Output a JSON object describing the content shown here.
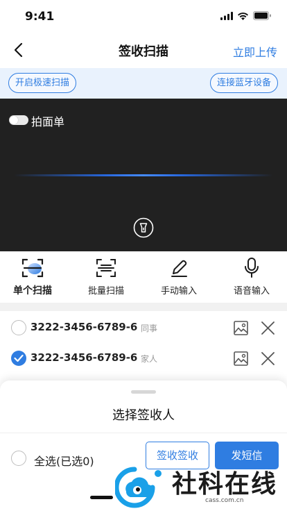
{
  "status_bar": {
    "time": "9:41"
  },
  "nav": {
    "title": "签收扫描",
    "action": "立即上传"
  },
  "options": {
    "fast_scan": "开启极速扫描",
    "bluetooth": "连接蓝牙设备"
  },
  "camera": {
    "toggle_label": "拍面单",
    "toggle_on": false
  },
  "modes": [
    {
      "label": "单个扫描",
      "icon": "scan-frame-icon",
      "active": true
    },
    {
      "label": "批量扫描",
      "icon": "batch-scan-icon",
      "active": false
    },
    {
      "label": "手动输入",
      "icon": "pen-icon",
      "active": false
    },
    {
      "label": "语音输入",
      "icon": "microphone-icon",
      "active": false
    }
  ],
  "items": [
    {
      "number": "3222-3456-6789-6",
      "tag": "同事",
      "checked": false
    },
    {
      "number": "3222-3456-6789-6",
      "tag": "家人",
      "checked": true
    }
  ],
  "sheet": {
    "title": "选择签收人",
    "select_all": "全选(已选0)",
    "confirm_label": "签收签收",
    "send_label": "发短信"
  },
  "watermark": {
    "brand": "社科在线",
    "url": "cass.com.cn"
  },
  "colors": {
    "accent": "#2f7de1",
    "camera_bg": "#212121",
    "option_bar_bg": "#e9f2fd"
  }
}
